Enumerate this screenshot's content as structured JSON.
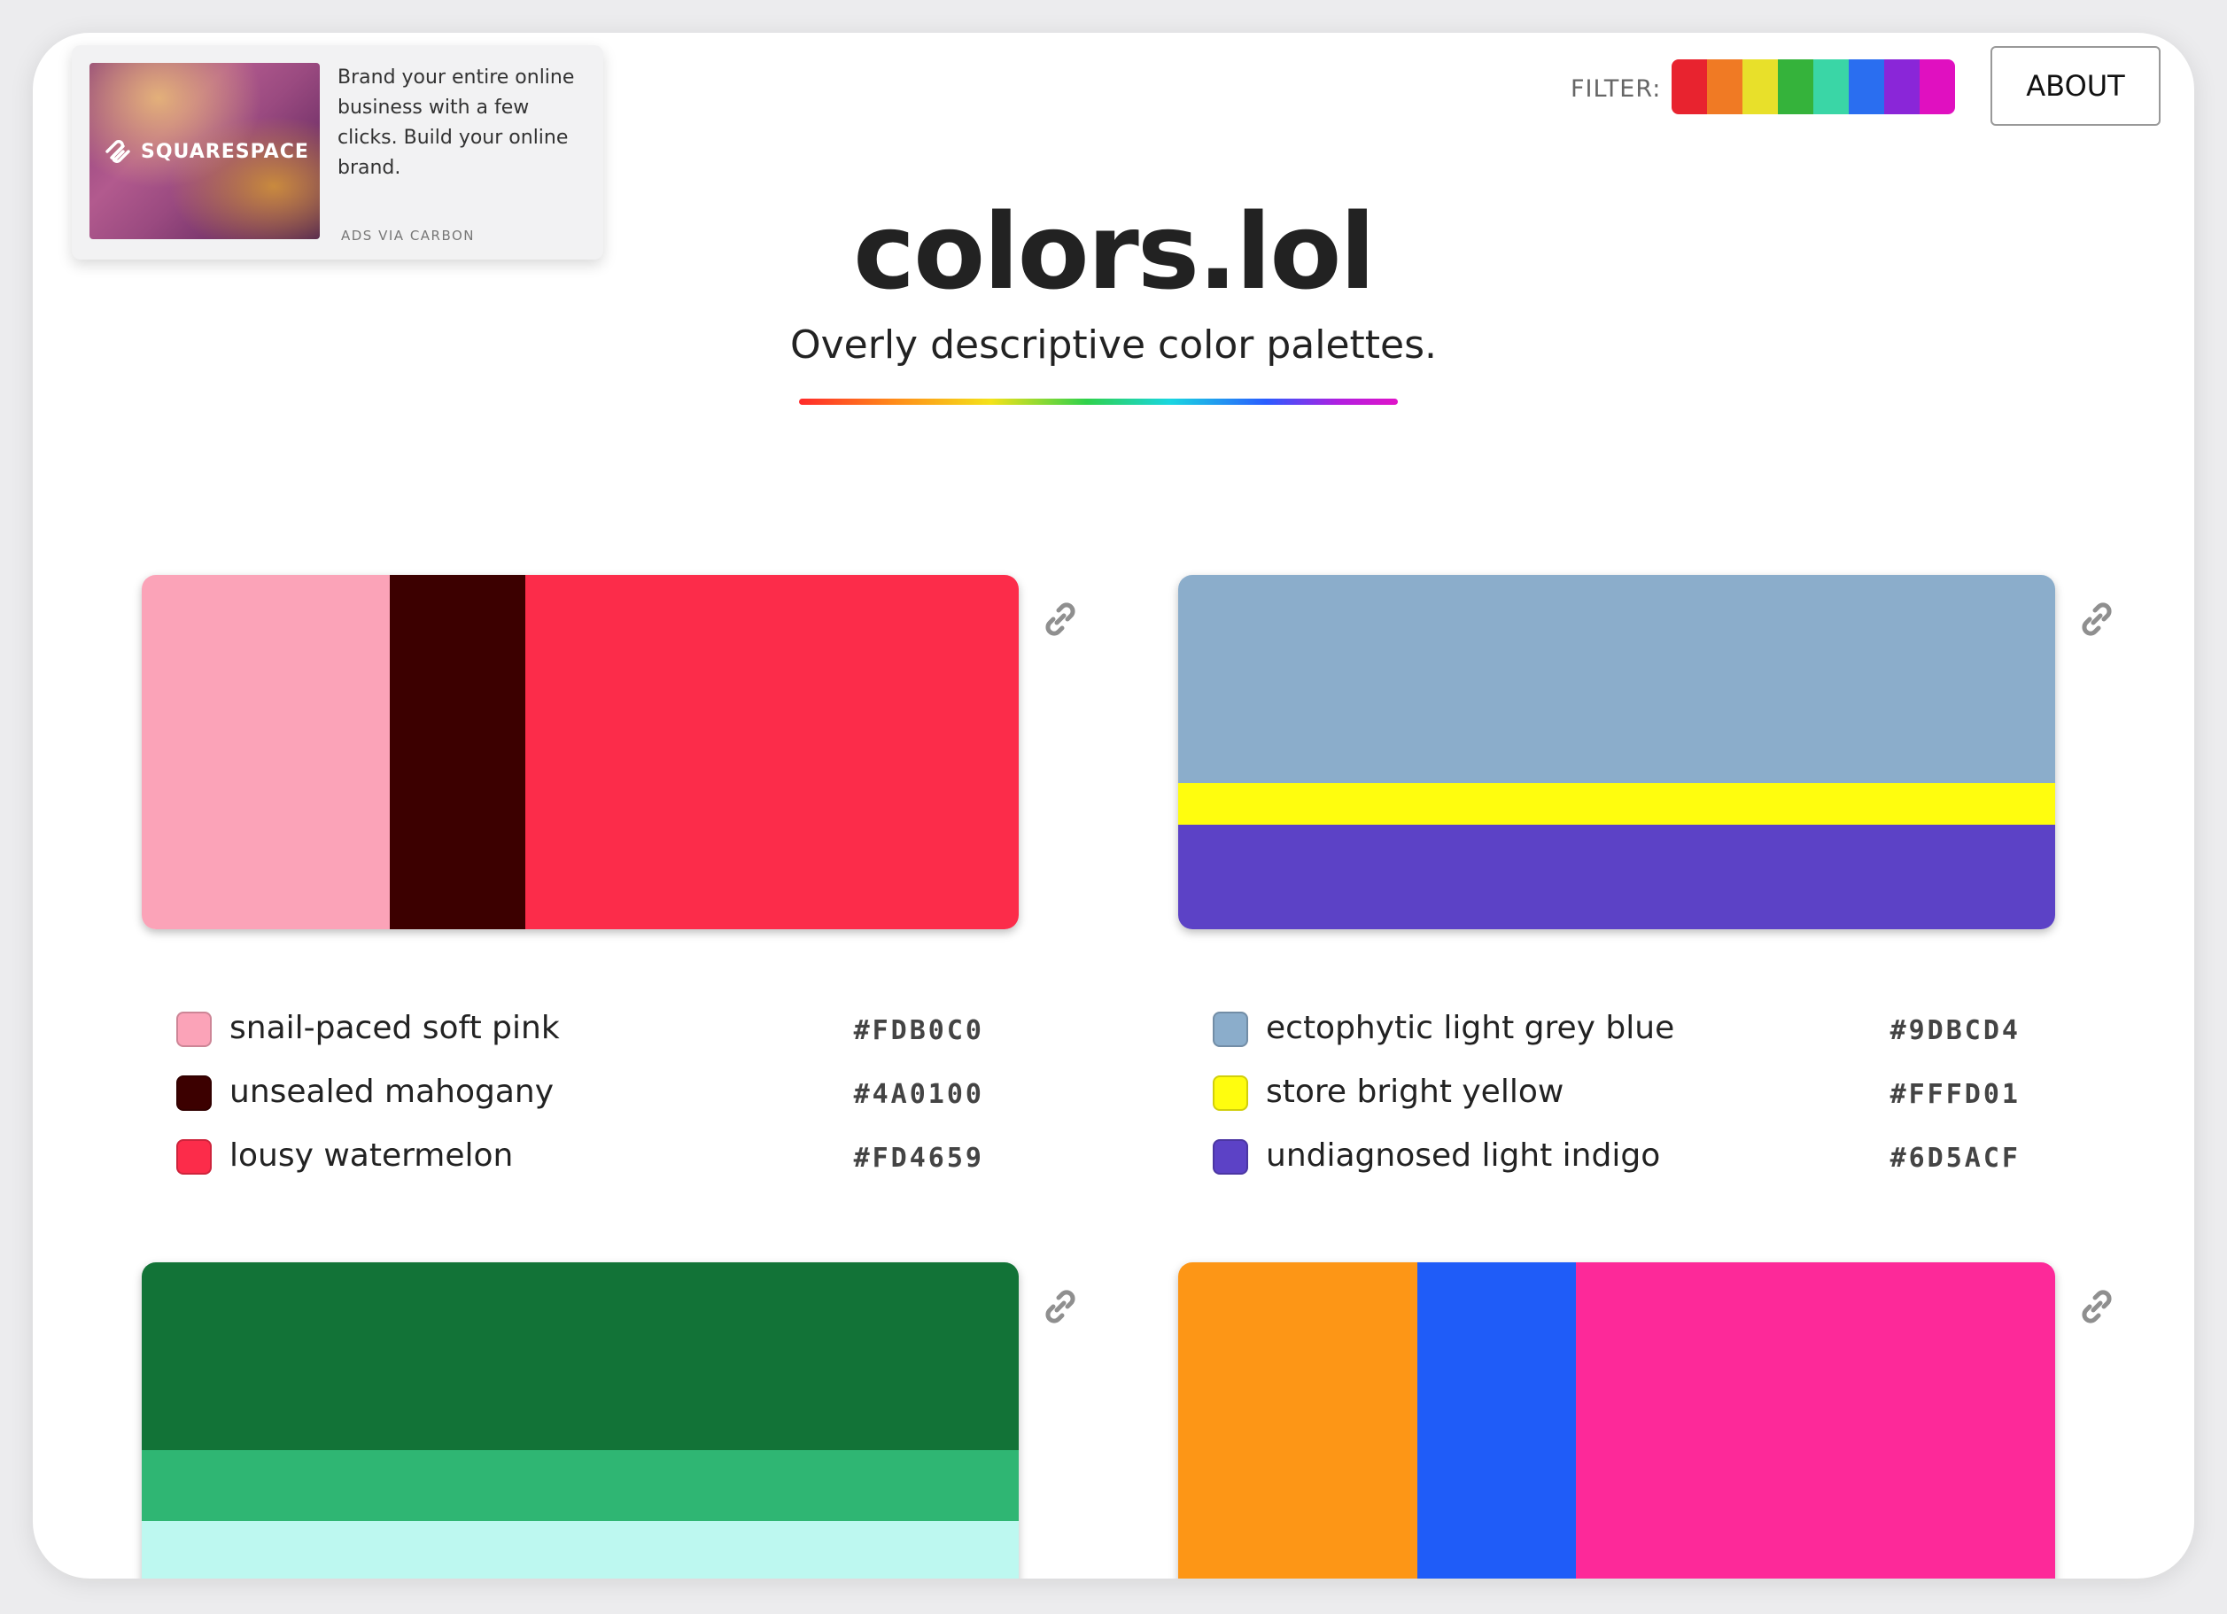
{
  "ad": {
    "brand": "SQUARESPACE",
    "text": "Brand your entire online business with a few clicks. Build your online brand.",
    "via": "ADS VIA CARBON"
  },
  "header": {
    "filter_label": "FILTER:",
    "filter_colors": [
      "#e8232f",
      "#f07a24",
      "#e8e02a",
      "#35b33b",
      "#3ad6a6",
      "#2a6ef0",
      "#8a26d8",
      "#e010c0"
    ],
    "about_label": "ABOUT"
  },
  "title": "colors.lol",
  "subtitle": "Overly descriptive color palettes.",
  "palettes": [
    {
      "colors": [
        {
          "name": "snail-paced soft pink",
          "hex": "#FDB0C0",
          "swatch": "#fba3b8"
        },
        {
          "name": "unsealed mahogany",
          "hex": "#4A0100",
          "swatch": "#3c0000"
        },
        {
          "name": "lousy watermelon",
          "hex": "#FD4659",
          "swatch": "#fc2c4a"
        }
      ]
    },
    {
      "colors": [
        {
          "name": "ectophytic light grey blue",
          "hex": "#9DBCD4",
          "swatch": "#8badcb"
        },
        {
          "name": "store bright yellow",
          "hex": "#FFFD01",
          "swatch": "#fffd0e"
        },
        {
          "name": "undiagnosed light indigo",
          "hex": "#6D5ACF",
          "swatch": "#5c42c6"
        }
      ]
    },
    {
      "colors": [
        {
          "name": "",
          "hex": "",
          "swatch": "#127337"
        },
        {
          "name": "",
          "hex": "",
          "swatch": "#2fb673"
        },
        {
          "name": "",
          "hex": "",
          "swatch": "#bdf8f0"
        }
      ]
    },
    {
      "colors": [
        {
          "name": "",
          "hex": "",
          "swatch": "#fd9616"
        },
        {
          "name": "",
          "hex": "",
          "swatch": "#1f5cf8"
        },
        {
          "name": "",
          "hex": "",
          "swatch": "#fd2999"
        }
      ]
    }
  ]
}
